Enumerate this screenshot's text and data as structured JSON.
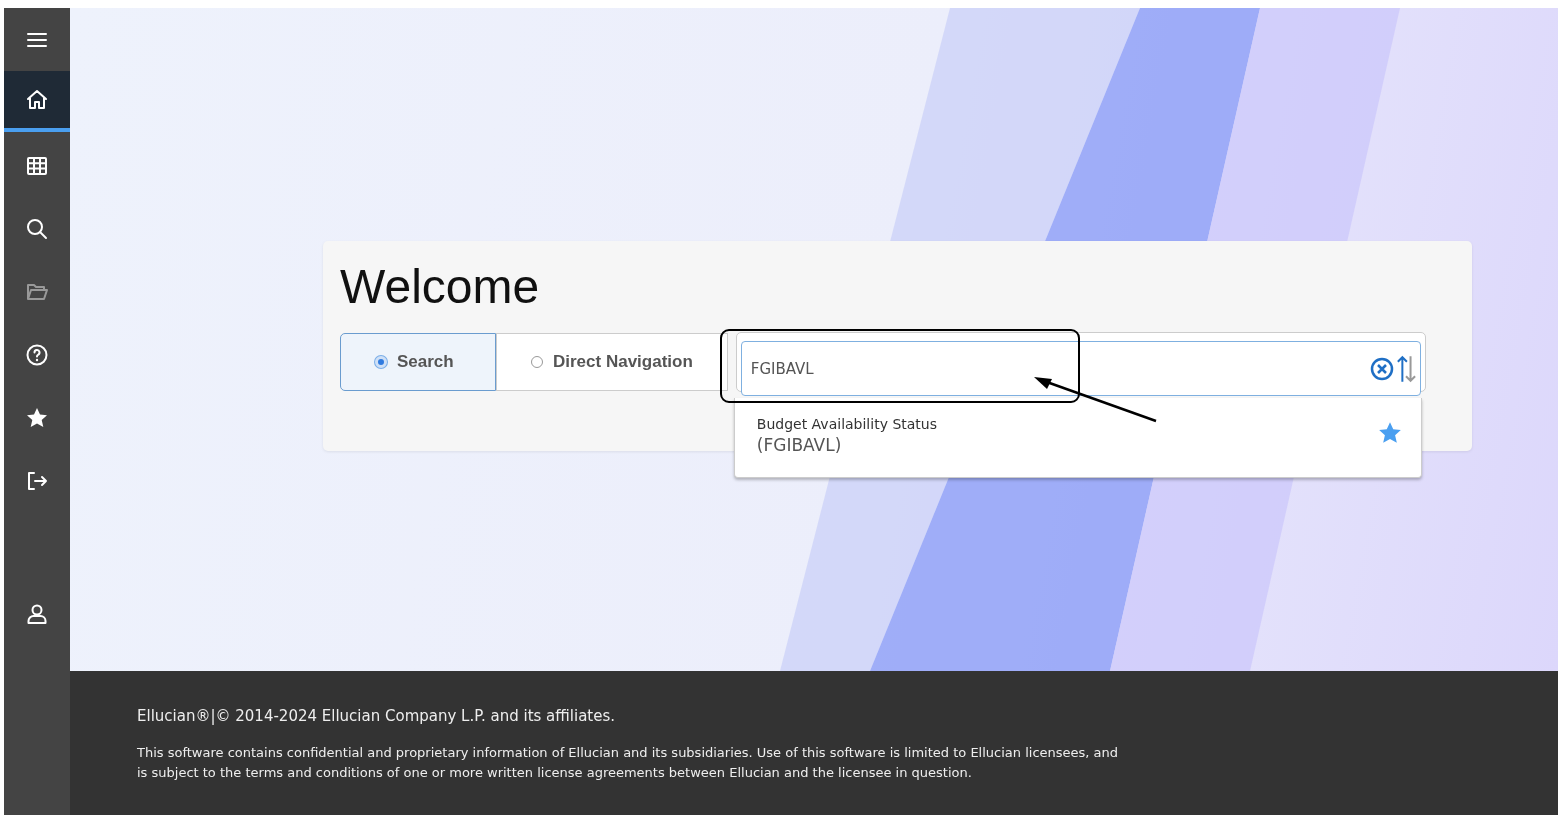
{
  "sidebar": {
    "items": [
      {
        "selected": false,
        "disabled": false
      },
      {
        "selected": true,
        "disabled": false
      },
      {
        "selected": false,
        "disabled": false
      },
      {
        "selected": false,
        "disabled": false
      },
      {
        "selected": false,
        "disabled": true
      },
      {
        "selected": false,
        "disabled": false
      },
      {
        "selected": false,
        "disabled": false
      },
      {
        "selected": false,
        "disabled": false
      },
      {
        "selected": false,
        "disabled": false
      }
    ]
  },
  "welcome": {
    "title": "Welcome",
    "modes": [
      {
        "label": "Search",
        "selected": true
      },
      {
        "label": "Direct Navigation",
        "selected": false
      }
    ],
    "search": {
      "value": "FGIBAVL"
    },
    "results": [
      {
        "title": "Budget Availability Status",
        "code": "(FGIBAVL)",
        "favorite": true
      }
    ]
  },
  "footer": {
    "copyright": "Ellucian®|© 2014-2024 Ellucian Company L.P. and its affiliates.",
    "notice": "This software contains confidential and proprietary information of Ellucian and its subsidiaries. Use of this software is limited to Ellucian licensees, and is subject to the terms and conditions of one or more written license agreements between Ellucian and the licensee in question."
  }
}
